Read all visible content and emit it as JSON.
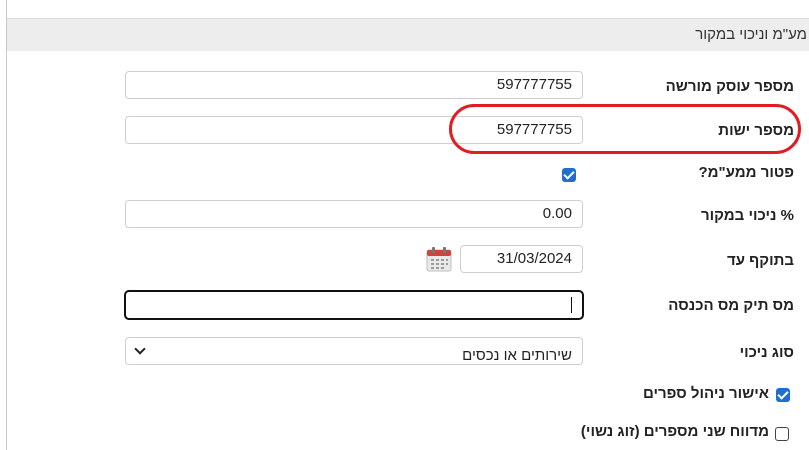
{
  "section": {
    "title": "מע\"מ וניכוי במקור"
  },
  "fields": {
    "dealer_number": {
      "label": "מספר עוסק מורשה",
      "value": "597777755"
    },
    "entity_number": {
      "label": "מספר ישות",
      "value": "597777755"
    },
    "vat_exempt": {
      "label": "פטור ממע\"מ?",
      "checked": true
    },
    "withholding_percent": {
      "label": "% ניכוי במקור",
      "value": "0.00"
    },
    "valid_until": {
      "label": "בתוקף עד",
      "value": "31/03/2024",
      "icon": "calendar-icon"
    },
    "tax_file": {
      "label": "מס תיק מס הכנסה",
      "value": ""
    },
    "deduction_type": {
      "label": "סוג ניכוי",
      "selected": "שירותים או נכסים"
    },
    "bookkeeping_approval": {
      "label": "אישור ניהול ספרים",
      "checked": true
    },
    "dual_report": {
      "label": "מדווח שני מספרים (זוג נשוי)",
      "checked": false
    }
  },
  "colors": {
    "highlight": "#e31b23",
    "checkbox": "#1f6fd1",
    "header_bg": "#ededed"
  }
}
